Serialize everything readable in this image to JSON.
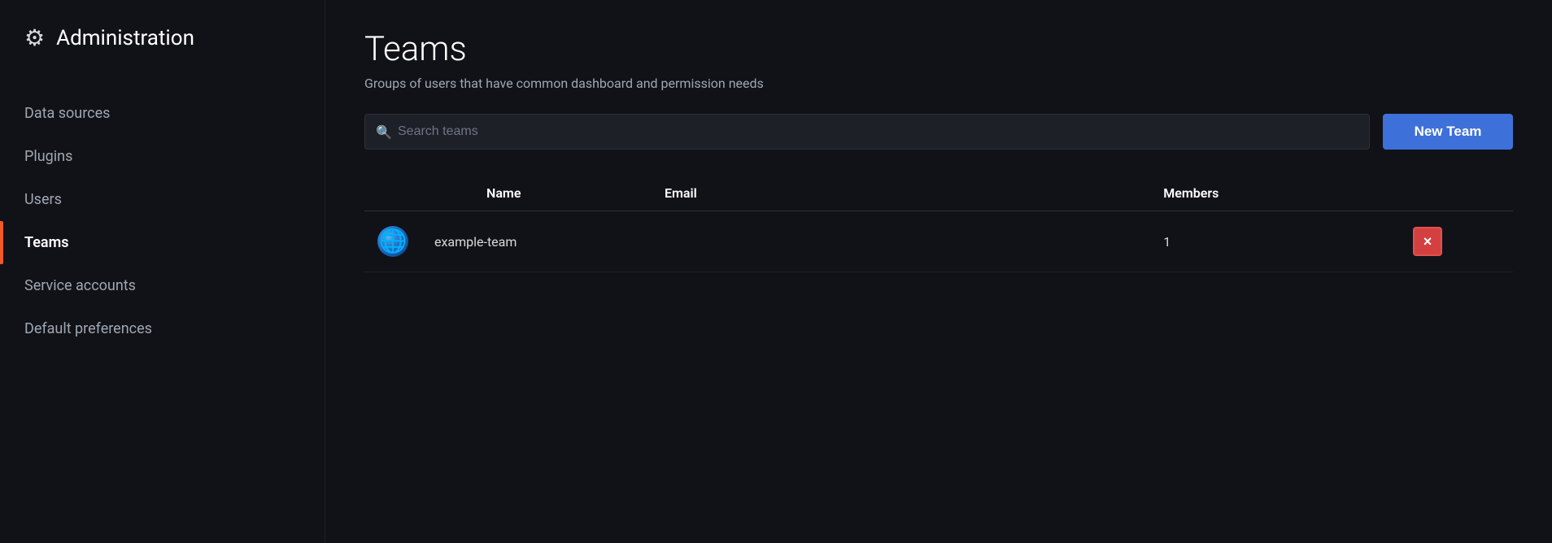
{
  "sidebar": {
    "title": "Administration",
    "gear_icon": "⚙",
    "items": [
      {
        "id": "data-sources",
        "label": "Data sources",
        "active": false
      },
      {
        "id": "plugins",
        "label": "Plugins",
        "active": false
      },
      {
        "id": "users",
        "label": "Users",
        "active": false
      },
      {
        "id": "teams",
        "label": "Teams",
        "active": true
      },
      {
        "id": "service-accounts",
        "label": "Service accounts",
        "active": false
      },
      {
        "id": "default-preferences",
        "label": "Default preferences",
        "active": false
      }
    ]
  },
  "main": {
    "page_title": "Teams",
    "page_subtitle": "Groups of users that have common dashboard and permission needs",
    "search_placeholder": "Search teams",
    "new_team_button": "New Team",
    "table": {
      "columns": [
        {
          "id": "name",
          "label": "Name"
        },
        {
          "id": "email",
          "label": "Email"
        },
        {
          "id": "members",
          "label": "Members"
        }
      ],
      "rows": [
        {
          "id": 1,
          "avatar": "🌐",
          "name": "example-team",
          "email": "",
          "members": "1"
        }
      ]
    }
  },
  "icons": {
    "gear": "⚙",
    "search": "🔍",
    "close": "×"
  }
}
